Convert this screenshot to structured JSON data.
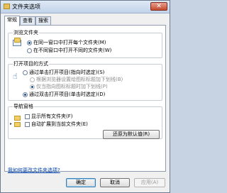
{
  "window": {
    "title": "文件夹选项",
    "close_symbol": "✕"
  },
  "tabs": [
    {
      "label": "常规",
      "active": true
    },
    {
      "label": "查看",
      "active": false
    },
    {
      "label": "搜索",
      "active": false
    }
  ],
  "browse": {
    "title": "浏览文件夹",
    "options": [
      {
        "label": "在同一窗口中打开每个文件夹(M)",
        "checked": true
      },
      {
        "label": "在不同窗口中打开不同的文件夹(W)",
        "checked": false
      }
    ]
  },
  "click": {
    "title": "打开项目的方式",
    "options": [
      {
        "label": "通过单击打开项目(指向时选定)(S)",
        "checked": false,
        "enabled": true
      },
      {
        "label": "根据浏览器设置给图标标题加下划线(B)",
        "checked": false,
        "enabled": false
      },
      {
        "label": "仅当指向图标标题时加下划线(P)",
        "checked": true,
        "enabled": false
      },
      {
        "label": "通过双击打开项目(单击时选定)(D)",
        "checked": true,
        "enabled": true
      }
    ]
  },
  "nav": {
    "title": "导航窗格",
    "options": [
      {
        "label": "显示所有文件夹(F)",
        "checked": false
      },
      {
        "label": "自动扩展到当前文件夹(E)",
        "checked": false
      }
    ]
  },
  "restore_label": "还原为默认值(R)",
  "help_link": "我如何更改文件夹选项?",
  "footer": {
    "ok": "确定",
    "cancel": "取消",
    "apply": "应用(A)"
  }
}
